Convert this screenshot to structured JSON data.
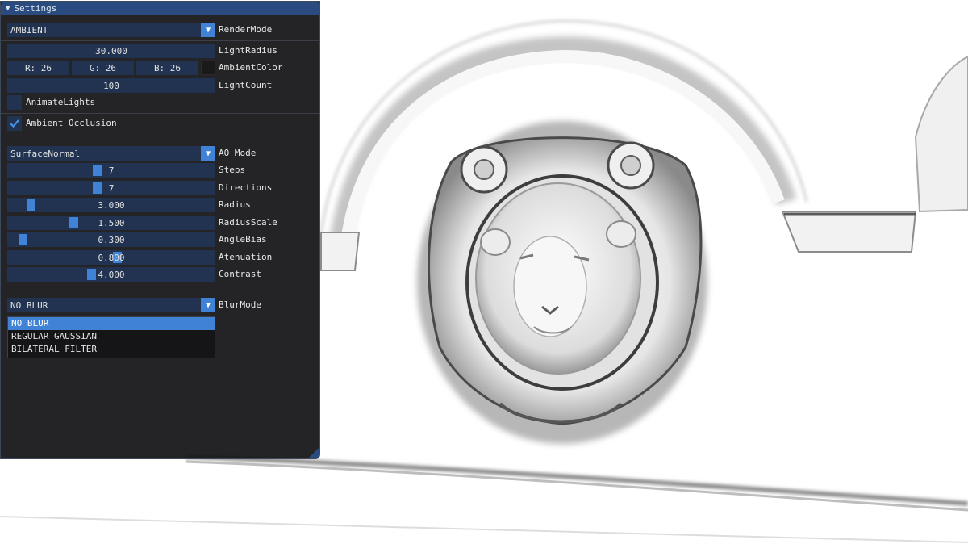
{
  "window": {
    "title": "Settings"
  },
  "render_mode": {
    "value": "AMBIENT",
    "label": "RenderMode"
  },
  "light_radius": {
    "value": "30.000",
    "label": "LightRadius"
  },
  "ambient_color": {
    "r": "R: 26",
    "g": "G: 26",
    "b": "B: 26",
    "label": "AmbientColor",
    "swatch": "#1a1a1a"
  },
  "light_count": {
    "value": "100",
    "label": "LightCount"
  },
  "animate_lights": {
    "label": "AnimateLights",
    "checked": false
  },
  "ambient_occlusion": {
    "label": "Ambient Occlusion",
    "checked": true
  },
  "ao_mode": {
    "value": "SurfaceNormal",
    "label": "AO Mode"
  },
  "sliders": [
    {
      "value": "7",
      "label": "Steps",
      "fraction": 0.43
    },
    {
      "value": "7",
      "label": "Directions",
      "fraction": 0.43
    },
    {
      "value": "3.000",
      "label": "Radius",
      "fraction": 0.09
    },
    {
      "value": "1.500",
      "label": "RadiusScale",
      "fraction": 0.31
    },
    {
      "value": "0.300",
      "label": "AngleBias",
      "fraction": 0.05
    },
    {
      "value": "0.800",
      "label": "Atenuation",
      "fraction": 0.53
    },
    {
      "value": "4.000",
      "label": "Contrast",
      "fraction": 0.4
    }
  ],
  "blur_mode": {
    "value": "NO BLUR",
    "label": "BlurMode",
    "options": [
      "NO BLUR",
      "REGULAR GAUSSIAN",
      "BILATERAL FILTER"
    ]
  },
  "colors": {
    "accent": "#3f82d6",
    "frame_bg": "#213350",
    "title_bg": "#2a4b7f",
    "window_bg": "#161618"
  },
  "icons": {
    "collapse": "collapse-triangle-icon",
    "combo": "chevron-down-icon",
    "check": "checkmark-icon"
  }
}
